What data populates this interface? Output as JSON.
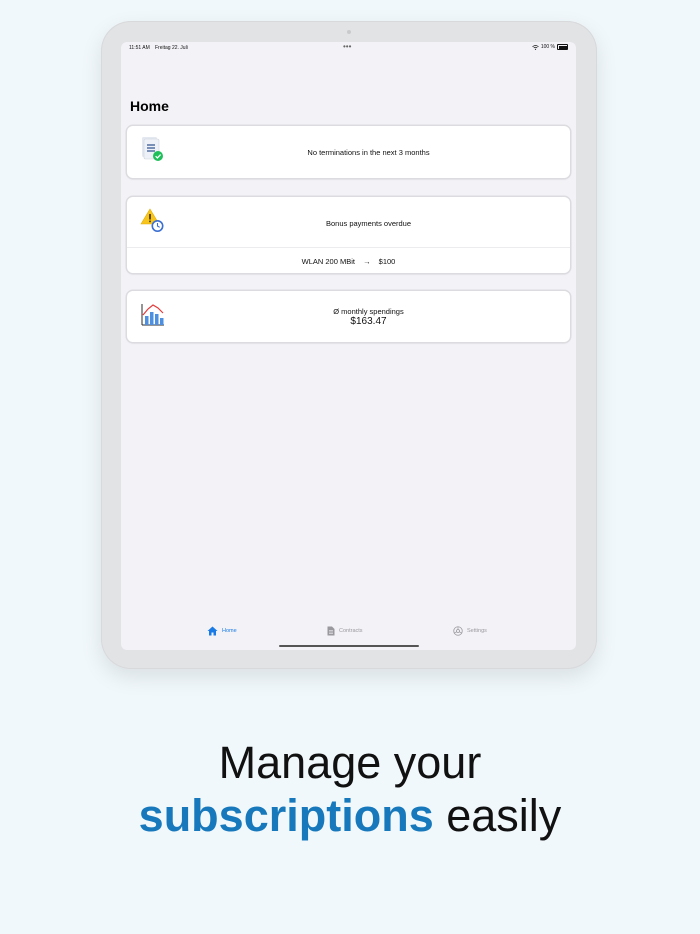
{
  "status_bar": {
    "time": "11:51 AM",
    "date": "Freitag 22. Juli",
    "multitask_dots": "•••",
    "battery": "100 %"
  },
  "header": {
    "title": "Home"
  },
  "cards": {
    "terminations": {
      "icon": "document-check-icon",
      "text": "No terminations in the next 3 months"
    },
    "bonus": {
      "icon": "warning-clock-icon",
      "text": "Bonus payments overdue",
      "row": {
        "name": "WLAN 200 MBit",
        "arrow": "→",
        "amount": "$100"
      }
    },
    "spendings": {
      "icon": "bar-chart-icon",
      "label": "Ø monthly spendings",
      "amount": "$163.47"
    }
  },
  "tab_bar": {
    "items": [
      {
        "label": "Home",
        "icon": "home-icon",
        "active": true
      },
      {
        "label": "Contracts",
        "icon": "document-icon",
        "active": false
      },
      {
        "label": "Settings",
        "icon": "gear-icon",
        "active": false
      }
    ]
  },
  "marketing": {
    "line1": "Manage your",
    "line2_accent": "subscriptions",
    "line2_rest": "easily"
  },
  "colors": {
    "accent_blue": "#1779bc",
    "tab_active": "#1a7be6",
    "background": "#f1f8fc"
  }
}
